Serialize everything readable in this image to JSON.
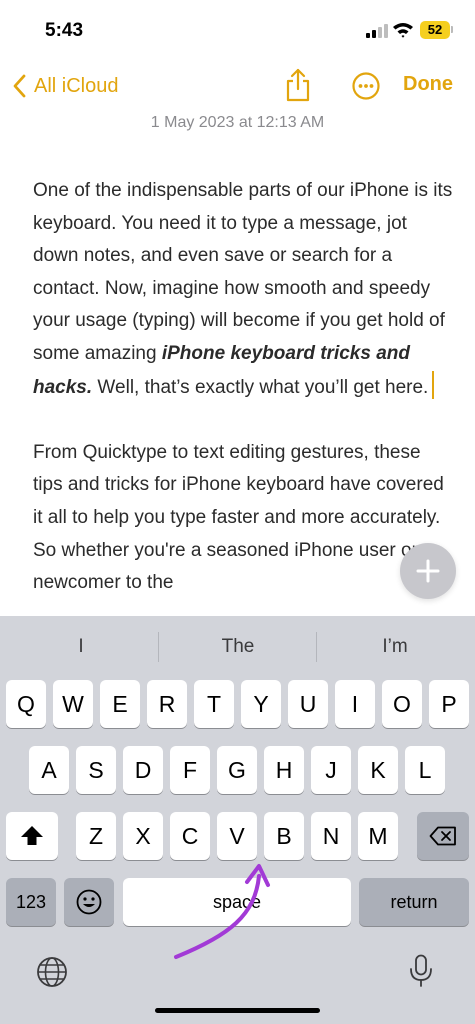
{
  "status_bar": {
    "time": "5:43",
    "battery": "52"
  },
  "nav": {
    "back_label": "All iCloud",
    "done_label": "Done"
  },
  "note": {
    "date": "1 May 2023 at 12:13 AM",
    "p1_start": "One of the indispensable parts of our iPhone is its keyboard. You need it to type a message, jot down notes, and even save or search for a contact. Now, imagine how smooth and speedy your usage (typing) will become if you get hold of some amazing ",
    "p1_emphasis": "iPhone keyboard tricks and hacks.",
    "p1_end": " Well, that’s exactly what you’ll get here.",
    "p2": "From Quicktype to text editing gestures, these tips and tricks for iPhone keyboard have covered it all to help you type faster and more accurately. So whether you're a seasoned iPhone user or a newcomer to the"
  },
  "keyboard": {
    "suggestions": [
      "I",
      "The",
      "I’m"
    ],
    "row1": [
      "Q",
      "W",
      "E",
      "R",
      "T",
      "Y",
      "U",
      "I",
      "O",
      "P"
    ],
    "row2": [
      "A",
      "S",
      "D",
      "F",
      "G",
      "H",
      "J",
      "K",
      "L"
    ],
    "row3": [
      "Z",
      "X",
      "C",
      "V",
      "B",
      "N",
      "M"
    ],
    "numbers_label": "123",
    "space_label": "space",
    "return_label": "return"
  },
  "colors": {
    "accent": "#e2a50e",
    "annotation_arrow": "#a23ad6",
    "keyboard_bg": "#d2d4da"
  }
}
